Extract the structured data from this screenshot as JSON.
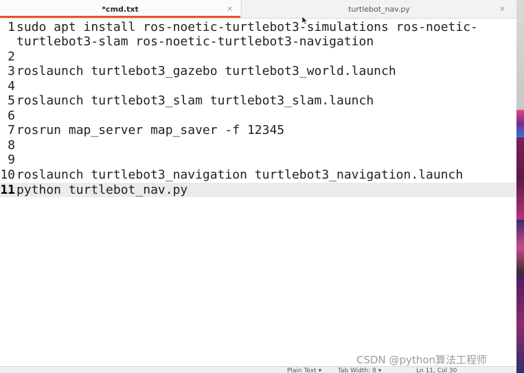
{
  "tabs": [
    {
      "label": "*cmd.txt",
      "active": true,
      "close": "×"
    },
    {
      "label": "turtlebot_nav.py",
      "active": false,
      "close": "×"
    }
  ],
  "editor": {
    "line_numbers": [
      "1",
      "2",
      "3",
      "4",
      "5",
      "6",
      "7",
      "8",
      "9",
      "10",
      "11"
    ],
    "current_line": "11",
    "code_lines": [
      "sudo apt install ros-noetic-turtlebot3-simulations ros-noetic-",
      "turtlebot3-slam ros-noetic-turtlebot3-navigation",
      "",
      "roslaunch turtlebot3_gazebo turtlebot3_world.launch",
      "",
      "roslaunch turtlebot3_slam turtlebot3_slam.launch",
      "",
      "rosrun map_server map_saver -f 12345",
      "",
      "",
      "roslaunch turtlebot3_navigation turtlebot3_navigation.launch",
      "python turtlebot_nav.py"
    ]
  },
  "statusbar": {
    "language": "Plain Text ▾",
    "tab_width": "Tab Width: 8 ▾",
    "position": "Ln 11, Col 30"
  },
  "watermark": "CSDN @python算法工程师",
  "colors": {
    "accent": "#e95420",
    "tab_bg": "#f2f2f2",
    "current_line_bg": "#ebebeb"
  }
}
